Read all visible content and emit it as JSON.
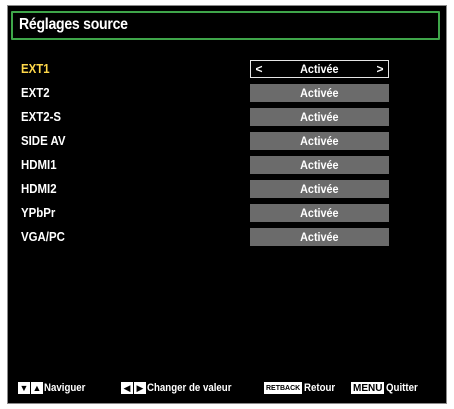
{
  "menu": {
    "title": "Réglages source",
    "items": [
      {
        "label": "EXT1",
        "value": "Activée"
      },
      {
        "label": "EXT2",
        "value": "Activée"
      },
      {
        "label": "EXT2-S",
        "value": "Activée"
      },
      {
        "label": "SIDE AV",
        "value": "Activée"
      },
      {
        "label": "HDMI1",
        "value": "Activée"
      },
      {
        "label": "HDMI2",
        "value": "Activée"
      },
      {
        "label": "YPbPr",
        "value": "Activée"
      },
      {
        "label": "VGA/PC",
        "value": "Activée"
      }
    ],
    "selected_index": 0
  },
  "footer": {
    "navigate_label": "Naviguer",
    "change_label": "Changer de valeur",
    "return_key": "RETBACK",
    "return_label": "Retour",
    "menu_key": "MENU",
    "quit_label": "Quitter"
  },
  "colors": {
    "title_border": "#3fa64a",
    "selected_label": "#ffd84a",
    "value_box": "#6b6b6b",
    "background": "#000000"
  }
}
